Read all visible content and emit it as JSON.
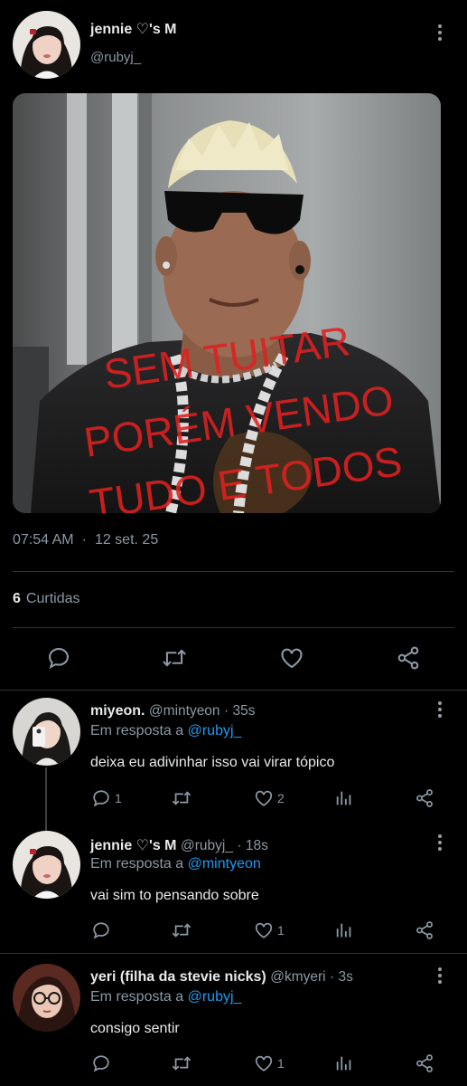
{
  "main_tweet": {
    "name": "jennie ♡'s M",
    "handle": "@rubyj_",
    "image_text": [
      "SEM TUITAR",
      "PORÉM VENDO",
      "TUDO E TODOS"
    ],
    "time": "07:54 AM",
    "separator": "·",
    "date": "12 set. 25",
    "likes_count": "6",
    "likes_label": "Curtidas"
  },
  "replies": [
    {
      "name": "miyeon.",
      "handle": "@mintyeon",
      "time": "· 35s",
      "reply_prefix": "Em resposta a",
      "reply_to": "@rubyj_",
      "text": "deixa eu adivinhar isso vai virar tópico",
      "reply_count": "1",
      "like_count": "2"
    },
    {
      "name": "jennie ♡'s M",
      "handle": "@rubyj_",
      "time": "· 18s",
      "reply_prefix": "Em resposta a",
      "reply_to": "@mintyeon",
      "text": "vai sim to pensando sobre",
      "reply_count": "",
      "like_count": "1"
    },
    {
      "name": "yeri (filha da stevie nicks)",
      "handle": "@kmyeri",
      "time": "· 3s",
      "reply_prefix": "Em resposta a",
      "reply_to": "@rubyj_",
      "text": "consigo sentir",
      "reply_count": "",
      "like_count": "1"
    }
  ],
  "icons": {
    "reply": "speech-bubble-icon",
    "retweet": "retweet-arrows-icon",
    "like": "heart-icon",
    "share": "share-nodes-icon",
    "views": "bar-chart-icon",
    "more": "vertical-dots-icon"
  },
  "colors": {
    "background": "#000000",
    "text": "#e7e9ea",
    "secondary": "#8b98a5",
    "link": "#1d9bf0",
    "divider": "#2f3336",
    "overlay_text": "#e02020"
  }
}
